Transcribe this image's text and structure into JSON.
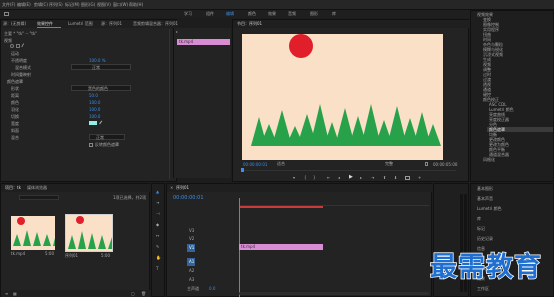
{
  "menubar": {
    "items": [
      "文件(F)",
      "编辑(E)",
      "剪辑(C)",
      "序列(S)",
      "标记(M)",
      "图形(G)",
      "视图(V)",
      "窗口(W)",
      "帮助(H)"
    ]
  },
  "workspace": {
    "tabs": [
      "学习",
      "组件",
      "编辑",
      "颜色",
      "效果",
      "音频",
      "图形",
      "库"
    ]
  },
  "source": {
    "tabs": [
      "源：(无剪辑)",
      "效果控件",
      "Lumetri 范围",
      "源：序列01",
      "音频剪辑混合器：序列01"
    ],
    "seq_label": "主要 * \"tk\" -- \"tk\"",
    "section_video": "视频",
    "rows": [
      {
        "label": "运动",
        "value": ""
      },
      {
        "label": "不透明度",
        "value": "100.0 %"
      },
      {
        "label": "混合模式",
        "value": "正常"
      },
      {
        "label": "时间重映射",
        "value": ""
      },
      {
        "label": "颜色遮罩",
        "value": ""
      },
      {
        "label": "形状",
        "value": "矩形"
      },
      {
        "label": "距离",
        "value": ""
      },
      {
        "label": "颜色",
        "value": "黑色的颜色"
      },
      {
        "label": "羽化",
        "value": "50.0"
      },
      {
        "label": "切换",
        "value": "100.0"
      },
      {
        "label": "宽度",
        "value": "100.0"
      },
      {
        "label": "斜面",
        "value": "100.0"
      },
      {
        "label": "混合",
        "value": "正常"
      }
    ],
    "mini_clip": "tk.mp4",
    "checkbox_label": "反转颜色遮罩"
  },
  "program": {
    "title": "节目：序列01",
    "timecode": "00:00:00:01",
    "fit": "适合",
    "quality": "完整",
    "duration": "00:00:05:00"
  },
  "effects": {
    "items": [
      "视频效果",
      "变换",
      "图像控制",
      "实用程序",
      "扭曲",
      "时间",
      "杂色与颗粒",
      "模糊与锐化",
      "沉浸式视频",
      "生成",
      "视频",
      "调整",
      "过时",
      "过渡",
      "透视",
      "通道",
      "键控",
      "颜色校正",
      "ASC CDL",
      "Lumetri 颜色",
      "亮度曲线",
      "亮度校正器",
      "分色",
      "颜色遮罩",
      "均衡",
      "更改颜色",
      "更改为颜色",
      "颜色平衡",
      "通道混合器",
      "风格化"
    ]
  },
  "right_panels": {
    "items": [
      "基本图形",
      "基本声音",
      "Lumetri 颜色",
      "库",
      "标记",
      "历史记录",
      "信息",
      "音频",
      "媒体浏览器",
      "效果",
      "工作区"
    ]
  },
  "project": {
    "tabs": [
      "项目：tk",
      "媒体浏览器"
    ],
    "search_placeholder": "",
    "count": "1项已选择，共2项",
    "clips": [
      {
        "name": "tk.mp4",
        "duration": "5:00"
      },
      {
        "name": "序列01",
        "duration": "5:00"
      }
    ]
  },
  "timeline": {
    "tab": "序列01",
    "timecode": "00:00:00:01",
    "tracks_v": [
      "V3",
      "V2",
      "V1"
    ],
    "tracks_a": [
      "A1",
      "A2",
      "A3"
    ],
    "master": "主声道",
    "master_val": "0.0",
    "clip_label": "tk.mp4"
  },
  "watermark": "最需教育",
  "colors": {
    "accent": "#3d8ee6",
    "clip": "#d98cd4",
    "sun": "#e01f2a",
    "sky": "#f9e0c6",
    "tree": "#27a24a",
    "progress": "#c93a3a"
  }
}
